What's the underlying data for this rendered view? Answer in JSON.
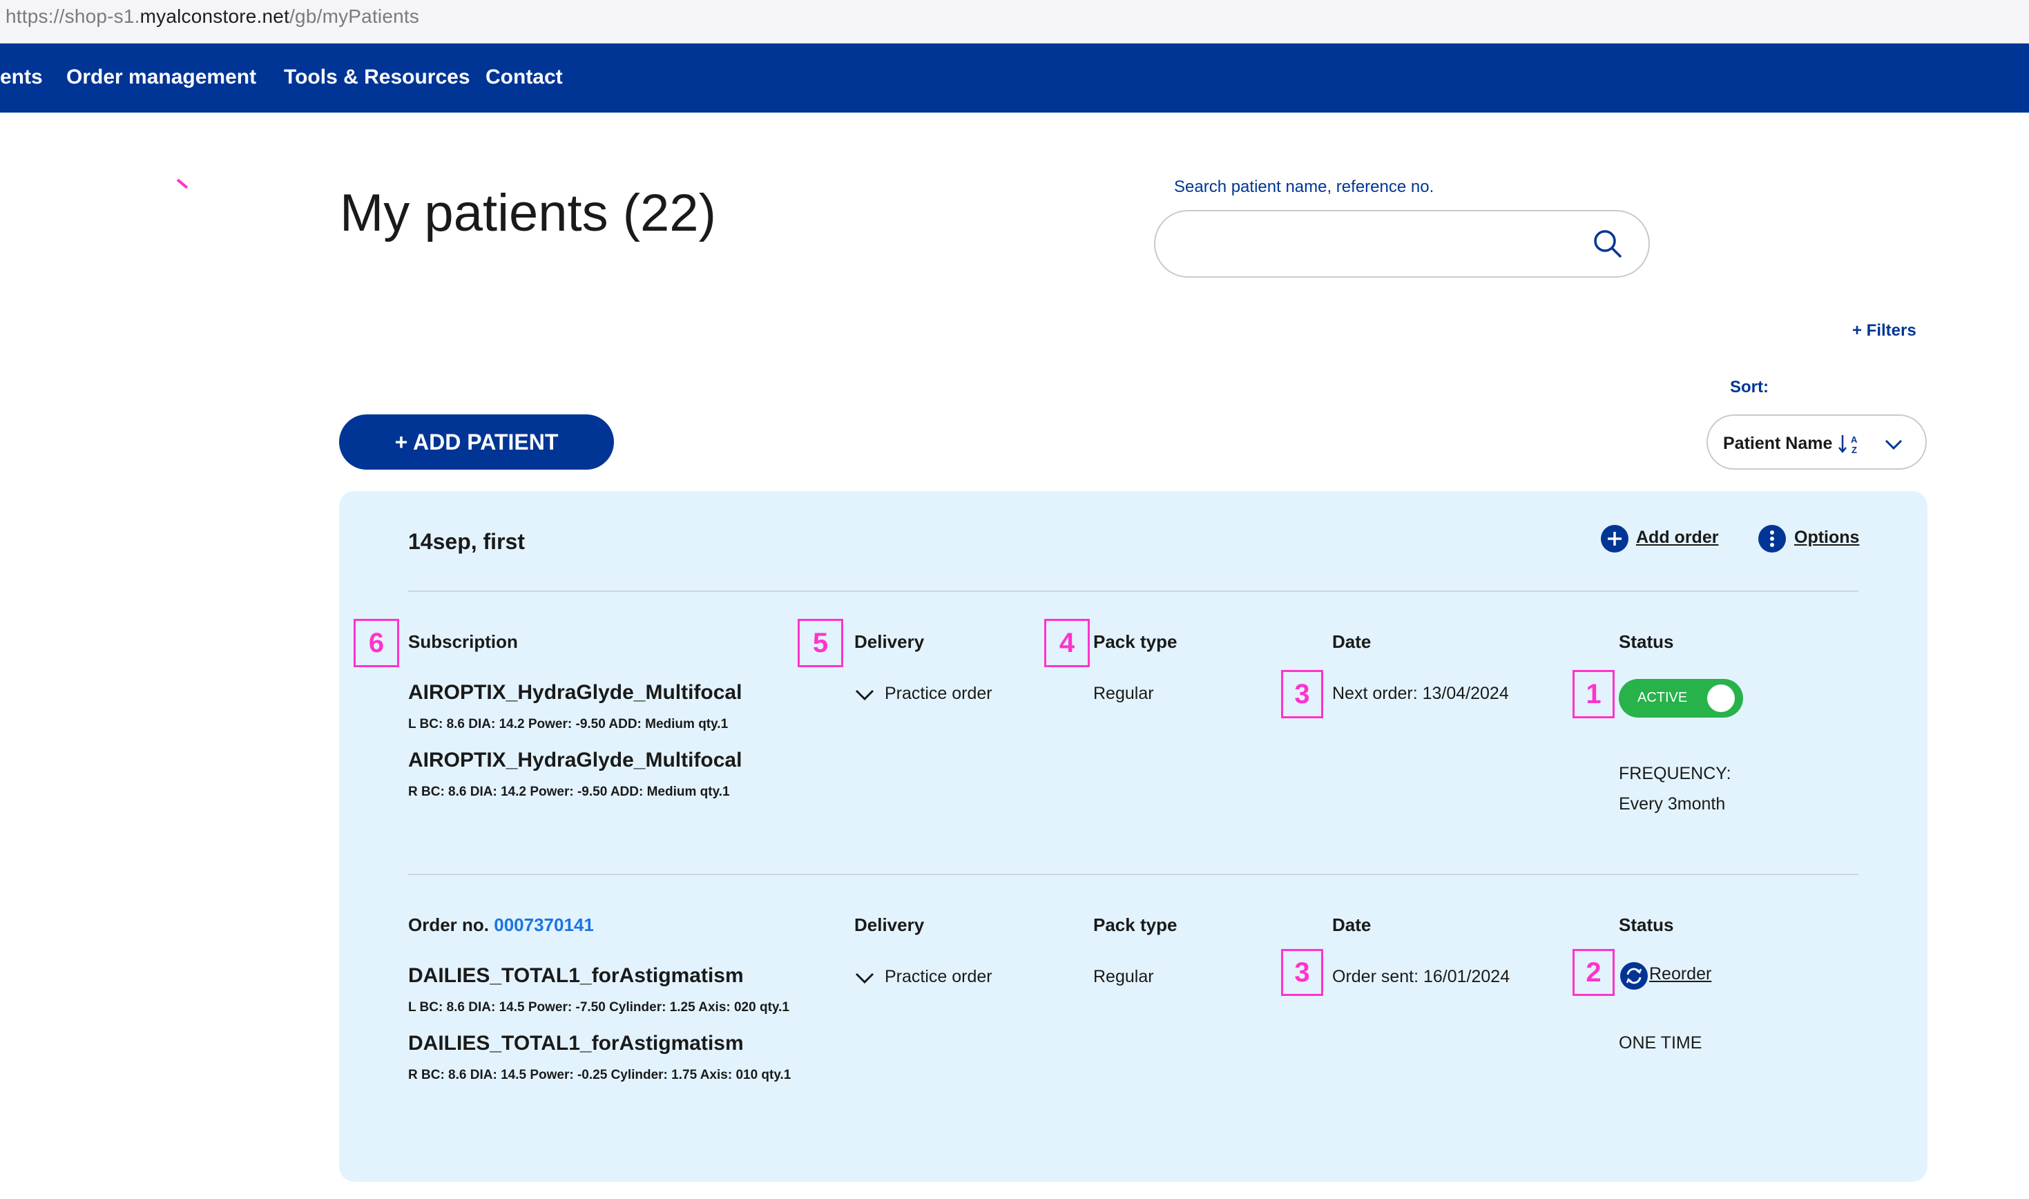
{
  "browser": {
    "url_prefix": "https://shop-s1.",
    "url_domain": "myalconstore.net",
    "url_path": "/gb/myPatients"
  },
  "nav": {
    "items": [
      "ents",
      "Order management",
      "Tools & Resources",
      "Contact"
    ]
  },
  "page": {
    "title": "My patients (22)",
    "search_label": "Search patient name, reference no.",
    "search_value": "",
    "filters_label": "+ Filters",
    "sort_label": "Sort:",
    "sort_value": "Patient Name",
    "sort_direction_glyph": "↓A Z",
    "add_patient_label": "+ ADD PATIENT"
  },
  "patient": {
    "name": "14sep, first",
    "add_order_label": "Add order",
    "options_label": "Options",
    "subscription": {
      "header_subscription": "Subscription",
      "header_delivery": "Delivery",
      "header_pack": "Pack type",
      "header_date": "Date",
      "header_status": "Status",
      "products": [
        {
          "name": "AIROPTIX_HydraGlyde_Multifocal",
          "detail": "L BC: 8.6 DIA: 14.2 Power: -9.50 ADD: Medium qty.1"
        },
        {
          "name": "AIROPTIX_HydraGlyde_Multifocal",
          "detail": "R BC: 8.6 DIA: 14.2 Power: -9.50 ADD: Medium qty.1"
        }
      ],
      "delivery": "Practice order",
      "pack_type": "Regular",
      "date": "Next order: 13/04/2024",
      "status_toggle": "ACTIVE",
      "status_on": true,
      "frequency_label": "FREQUENCY:",
      "frequency_value": "Every 3month"
    },
    "order": {
      "order_label": "Order no.",
      "order_number": "0007370141",
      "header_delivery": "Delivery",
      "header_pack": "Pack type",
      "header_date": "Date",
      "header_status": "Status",
      "products": [
        {
          "name": "DAILIES_TOTAL1_forAstigmatism",
          "detail": "L BC: 8.6 DIA: 14.5 Power: -7.50 Cylinder: 1.25 Axis: 020 qty.1"
        },
        {
          "name": "DAILIES_TOTAL1_forAstigmatism",
          "detail": "R BC: 8.6 DIA: 14.5 Power: -0.25 Cylinder: 1.75 Axis: 010 qty.1"
        }
      ],
      "delivery": "Practice order",
      "pack_type": "Regular",
      "date": "Order sent: 16/01/2024",
      "reorder_label": "Reorder",
      "frequency_value": "ONE TIME"
    }
  },
  "annotations": {
    "badge_6": "6",
    "badge_5": "5",
    "badge_4": "4",
    "badge_3a": "3",
    "badge_1": "1",
    "badge_3b": "3",
    "badge_2": "2"
  },
  "colors": {
    "brand_blue": "#003595",
    "card_bg": "#e3f3fd",
    "active_green": "#27b24a",
    "annotation_pink": "#ff33cc",
    "order_link": "#1b74e4"
  }
}
